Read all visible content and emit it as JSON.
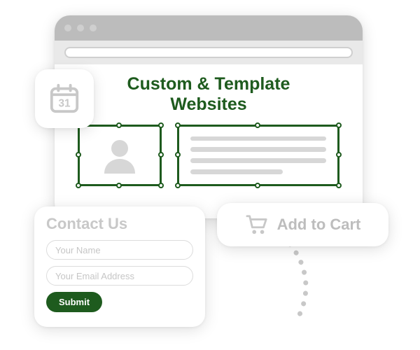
{
  "colors": {
    "brand": "#1e5b1e",
    "muted": "#bdbdbd"
  },
  "calendar": {
    "day": "31"
  },
  "browser": {
    "title": "Custom & Template\nWebsites"
  },
  "cart": {
    "label": "Add to Cart"
  },
  "contact": {
    "title": "Contact Us",
    "name_placeholder": "Your Name",
    "email_placeholder": "Your Email Address",
    "submit_label": "Submit"
  }
}
